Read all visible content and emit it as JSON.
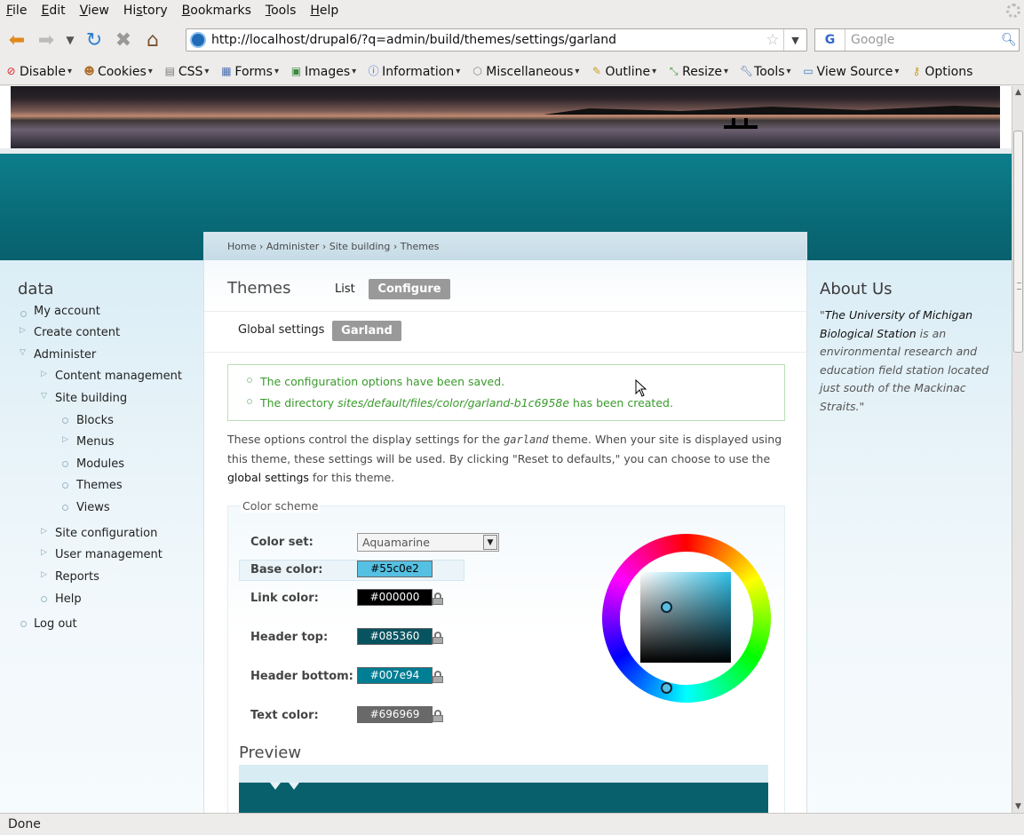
{
  "browser": {
    "menus": [
      "File",
      "Edit",
      "View",
      "History",
      "Bookmarks",
      "Tools",
      "Help"
    ],
    "menu_underline": [
      "F",
      "E",
      "V",
      "s",
      "B",
      "T",
      "H"
    ],
    "url": "http://localhost/drupal6/?q=admin/build/themes/settings/garland",
    "search_placeholder": "Google",
    "search_engine_glyph": "G",
    "toolbar": [
      "Disable",
      "Cookies",
      "CSS",
      "Forms",
      "Images",
      "Information",
      "Miscellaneous",
      "Outline",
      "Resize",
      "Tools",
      "View Source",
      "Options"
    ],
    "status": "Done"
  },
  "breadcrumb": "Home › Administer › Site building › Themes",
  "page": {
    "title": "Themes",
    "tabs": {
      "list": "List",
      "configure": "Configure"
    },
    "subtabs": {
      "global": "Global settings",
      "garland": "Garland"
    }
  },
  "messages": {
    "m1": "The configuration options have been saved.",
    "m2_pre": "The directory ",
    "m2_path": "sites/default/files/color/garland-b1c6958e",
    "m2_post": " has been created."
  },
  "description": {
    "p1": "These options control the display settings for the ",
    "theme": "garland",
    "p2": " theme. When your site is displayed using this theme, these settings will be used. By clicking \"Reset to defaults,\" you can choose to use the ",
    "link": "global settings",
    "p3": " for this theme."
  },
  "color_scheme": {
    "legend": "Color scheme",
    "color_set_label": "Color set:",
    "color_set_value": "Aquamarine",
    "fields": [
      {
        "label": "Base color:",
        "value": "#55c0e2",
        "color": "#55c0e2",
        "text_color": "#000000"
      },
      {
        "label": "Link color:",
        "value": "#000000",
        "color": "#000000",
        "text_color": "#ffffff"
      },
      {
        "label": "Header top:",
        "value": "#085360",
        "color": "#085360",
        "text_color": "#ffffff"
      },
      {
        "label": "Header bottom:",
        "value": "#007e94",
        "color": "#007e94",
        "text_color": "#ffffff"
      },
      {
        "label": "Text color:",
        "value": "#696969",
        "color": "#696969",
        "text_color": "#ffffff"
      }
    ],
    "preview_heading": "Preview"
  },
  "sidebar_left": {
    "heading": "data",
    "items": {
      "my_account": "My account",
      "create_content": "Create content",
      "administer": "Administer",
      "content_management": "Content management",
      "site_building": "Site building",
      "blocks": "Blocks",
      "menus": "Menus",
      "modules": "Modules",
      "themes": "Themes",
      "views": "Views",
      "site_configuration": "Site configuration",
      "user_management": "User management",
      "reports": "Reports",
      "help": "Help",
      "log_out": "Log out"
    }
  },
  "sidebar_right": {
    "heading": "About Us",
    "quote_open": "\"",
    "link": "The University of Michigan Biological Station",
    "text": " is an environmental research and education field station located just south of the Mackinac Straits.\""
  }
}
